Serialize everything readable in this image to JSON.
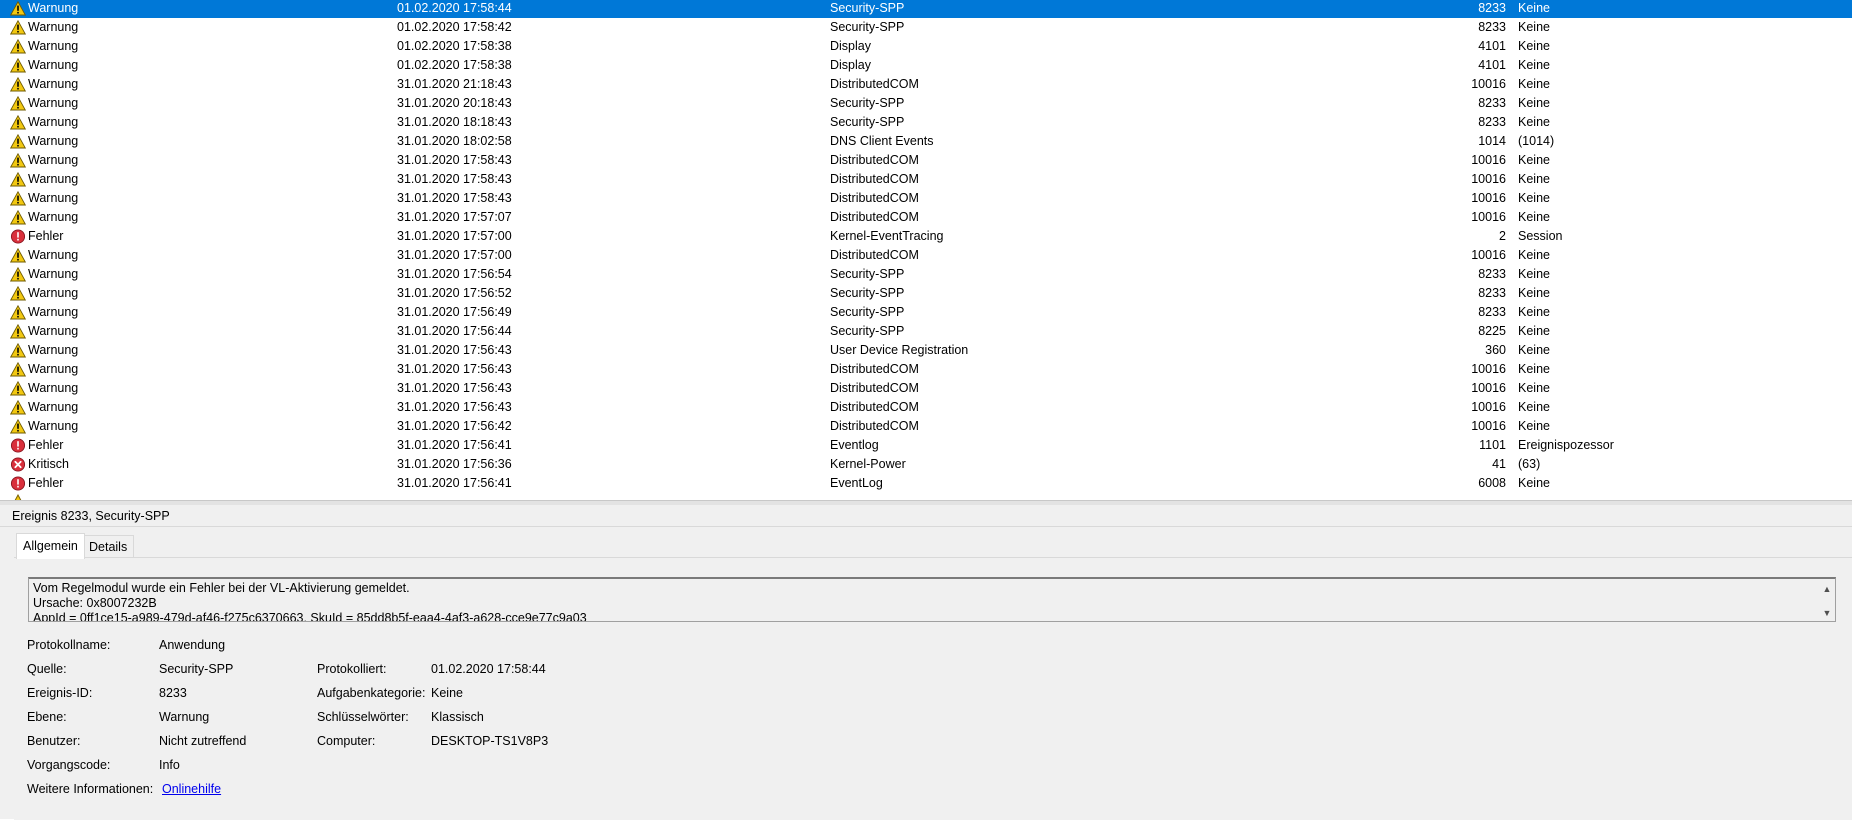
{
  "events": [
    {
      "level": "Warnung",
      "icon": "warning-icon",
      "date": "01.02.2020 17:58:44",
      "source": "Security-SPP",
      "id": "8233",
      "task": "Keine",
      "selected": true
    },
    {
      "level": "Warnung",
      "icon": "warning-icon",
      "date": "01.02.2020 17:58:42",
      "source": "Security-SPP",
      "id": "8233",
      "task": "Keine"
    },
    {
      "level": "Warnung",
      "icon": "warning-icon",
      "date": "01.02.2020 17:58:38",
      "source": "Display",
      "id": "4101",
      "task": "Keine"
    },
    {
      "level": "Warnung",
      "icon": "warning-icon",
      "date": "01.02.2020 17:58:38",
      "source": "Display",
      "id": "4101",
      "task": "Keine"
    },
    {
      "level": "Warnung",
      "icon": "warning-icon",
      "date": "31.01.2020 21:18:43",
      "source": "DistributedCOM",
      "id": "10016",
      "task": "Keine"
    },
    {
      "level": "Warnung",
      "icon": "warning-icon",
      "date": "31.01.2020 20:18:43",
      "source": "Security-SPP",
      "id": "8233",
      "task": "Keine"
    },
    {
      "level": "Warnung",
      "icon": "warning-icon",
      "date": "31.01.2020 18:18:43",
      "source": "Security-SPP",
      "id": "8233",
      "task": "Keine"
    },
    {
      "level": "Warnung",
      "icon": "warning-icon",
      "date": "31.01.2020 18:02:58",
      "source": "DNS Client Events",
      "id": "1014",
      "task": "(1014)"
    },
    {
      "level": "Warnung",
      "icon": "warning-icon",
      "date": "31.01.2020 17:58:43",
      "source": "DistributedCOM",
      "id": "10016",
      "task": "Keine"
    },
    {
      "level": "Warnung",
      "icon": "warning-icon",
      "date": "31.01.2020 17:58:43",
      "source": "DistributedCOM",
      "id": "10016",
      "task": "Keine"
    },
    {
      "level": "Warnung",
      "icon": "warning-icon",
      "date": "31.01.2020 17:58:43",
      "source": "DistributedCOM",
      "id": "10016",
      "task": "Keine"
    },
    {
      "level": "Warnung",
      "icon": "warning-icon",
      "date": "31.01.2020 17:57:07",
      "source": "DistributedCOM",
      "id": "10016",
      "task": "Keine"
    },
    {
      "level": "Fehler",
      "icon": "error-icon",
      "date": "31.01.2020 17:57:00",
      "source": "Kernel-EventTracing",
      "id": "2",
      "task": "Session"
    },
    {
      "level": "Warnung",
      "icon": "warning-icon",
      "date": "31.01.2020 17:57:00",
      "source": "DistributedCOM",
      "id": "10016",
      "task": "Keine"
    },
    {
      "level": "Warnung",
      "icon": "warning-icon",
      "date": "31.01.2020 17:56:54",
      "source": "Security-SPP",
      "id": "8233",
      "task": "Keine"
    },
    {
      "level": "Warnung",
      "icon": "warning-icon",
      "date": "31.01.2020 17:56:52",
      "source": "Security-SPP",
      "id": "8233",
      "task": "Keine"
    },
    {
      "level": "Warnung",
      "icon": "warning-icon",
      "date": "31.01.2020 17:56:49",
      "source": "Security-SPP",
      "id": "8233",
      "task": "Keine"
    },
    {
      "level": "Warnung",
      "icon": "warning-icon",
      "date": "31.01.2020 17:56:44",
      "source": "Security-SPP",
      "id": "8225",
      "task": "Keine"
    },
    {
      "level": "Warnung",
      "icon": "warning-icon",
      "date": "31.01.2020 17:56:43",
      "source": "User Device Registration",
      "id": "360",
      "task": "Keine"
    },
    {
      "level": "Warnung",
      "icon": "warning-icon",
      "date": "31.01.2020 17:56:43",
      "source": "DistributedCOM",
      "id": "10016",
      "task": "Keine"
    },
    {
      "level": "Warnung",
      "icon": "warning-icon",
      "date": "31.01.2020 17:56:43",
      "source": "DistributedCOM",
      "id": "10016",
      "task": "Keine"
    },
    {
      "level": "Warnung",
      "icon": "warning-icon",
      "date": "31.01.2020 17:56:43",
      "source": "DistributedCOM",
      "id": "10016",
      "task": "Keine"
    },
    {
      "level": "Warnung",
      "icon": "warning-icon",
      "date": "31.01.2020 17:56:42",
      "source": "DistributedCOM",
      "id": "10016",
      "task": "Keine"
    },
    {
      "level": "Fehler",
      "icon": "error-icon",
      "date": "31.01.2020 17:56:41",
      "source": "Eventlog",
      "id": "1101",
      "task": "Ereignispozessor"
    },
    {
      "level": "Kritisch",
      "icon": "critical-icon",
      "date": "31.01.2020 17:56:36",
      "source": "Kernel-Power",
      "id": "41",
      "task": "(63)"
    },
    {
      "level": "Fehler",
      "icon": "error-icon",
      "date": "31.01.2020 17:56:41",
      "source": "EventLog",
      "id": "6008",
      "task": "Keine"
    }
  ],
  "details": {
    "title": "Ereignis 8233, Security-SPP",
    "tabs": [
      "Allgemein",
      "Details"
    ],
    "description": [
      "Vom Regelmodul wurde ein Fehler bei der VL-Aktivierung gemeldet.",
      "Ursache: 0x8007232B",
      "AppId = 0ff1ce15-a989-479d-af46-f275c6370663, SkuId = 85dd8b5f-eaa4-4af3-a628-cce9e77c9a03"
    ],
    "labels": {
      "log_name": "Protokollname:",
      "source": "Quelle:",
      "event_id": "Ereignis-ID:",
      "level": "Ebene:",
      "user": "Benutzer:",
      "opcode": "Vorgangscode:",
      "more_info": "Weitere Informationen:",
      "logged": "Protokolliert:",
      "task_category": "Aufgabenkategorie:",
      "keywords": "Schlüsselwörter:",
      "computer": "Computer:"
    },
    "values": {
      "log_name": "Anwendung",
      "source": "Security-SPP",
      "event_id": "8233",
      "level": "Warnung",
      "user": "Nicht zutreffend",
      "opcode": "Info",
      "more_info": "Onlinehilfe",
      "logged": "01.02.2020 17:58:44",
      "task_category": "Keine",
      "keywords": "Klassisch",
      "computer": "DESKTOP-TS1V8P3"
    }
  },
  "colors": {
    "selection": "#0078d7",
    "warning": "#f2c811",
    "error": "#d9303c",
    "link": "#0000ee"
  }
}
